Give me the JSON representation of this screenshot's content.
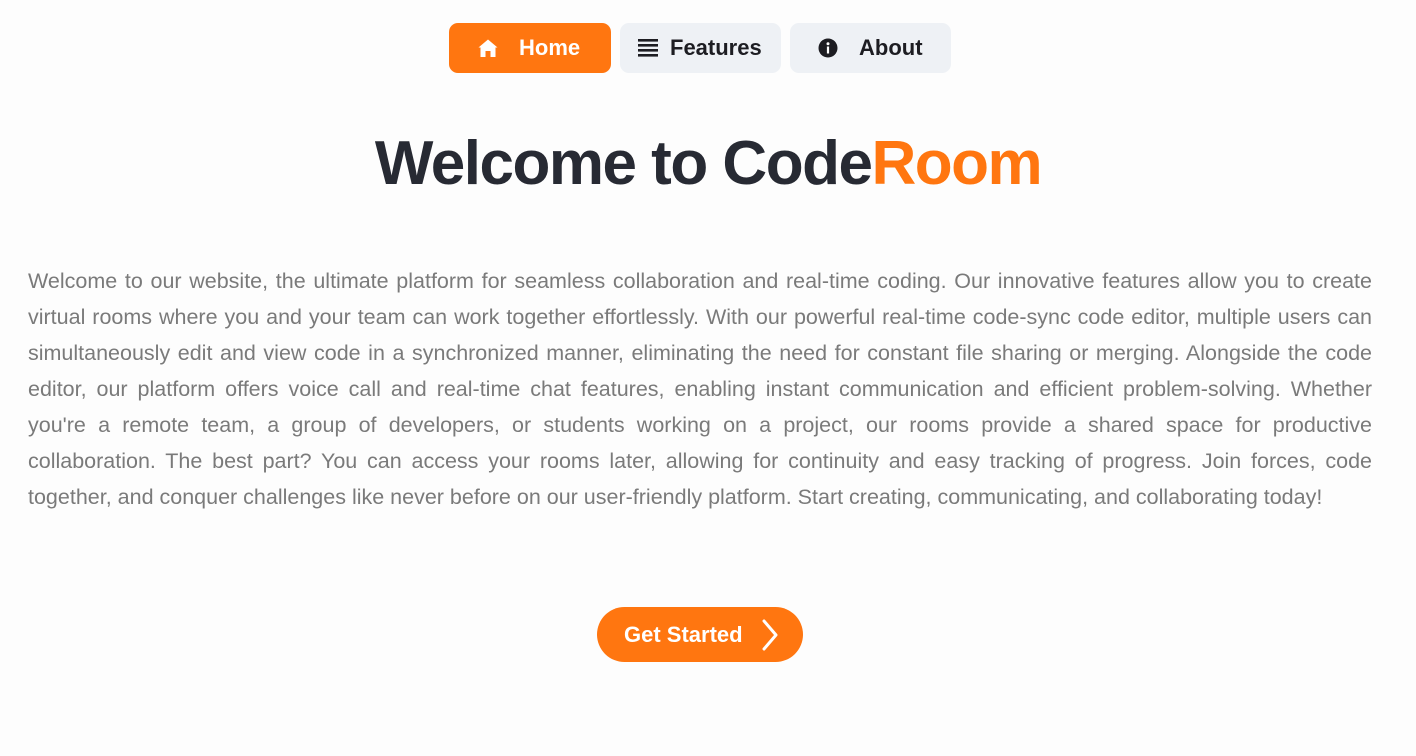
{
  "nav": {
    "items": [
      {
        "label": "Home",
        "icon": "home-icon",
        "active": true
      },
      {
        "label": "Features",
        "icon": "list-icon",
        "active": false
      },
      {
        "label": "About",
        "icon": "info-icon",
        "active": false
      }
    ]
  },
  "hero": {
    "title_main": "Welcome to Code",
    "title_accent": "Room",
    "description": "Welcome to our website, the ultimate platform for seamless collaboration and real-time coding. Our innovative features allow you to create virtual rooms where you and your team can work together effortlessly. With our powerful real-time code-sync code editor, multiple users can simultaneously edit and view code in a synchronized manner, eliminating the need for constant file sharing or merging. Alongside the code editor, our platform offers voice call and real-time chat features, enabling instant communication and efficient problem-solving. Whether you're a remote team, a group of developers, or students working on a project, our rooms provide a shared space for productive collaboration. The best part? You can access your rooms later, allowing for continuity and easy tracking of progress. Join forces, code together, and conquer challenges like never before on our user-friendly platform. Start creating, communicating, and collaborating today!",
    "cta_label": "Get Started",
    "cta_icon": "chevron-right-icon"
  },
  "colors": {
    "accent": "#ff7610",
    "title": "#272a33",
    "body_text": "#7a7a7a",
    "nav_inactive_bg": "#eef1f5"
  }
}
